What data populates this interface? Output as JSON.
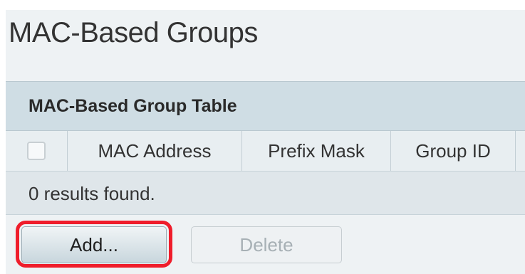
{
  "page": {
    "title": "MAC-Based Groups"
  },
  "table": {
    "title": "MAC-Based Group Table",
    "columns": [
      "",
      "MAC Address",
      "Prefix Mask",
      "Group ID"
    ],
    "results_text": "0 results found."
  },
  "actions": {
    "add_label": "Add...",
    "delete_label": "Delete"
  },
  "colors": {
    "background": "#eef2f4",
    "table_header": "#cfdde4",
    "results_row": "#dfe6ea",
    "highlight": "#ef1d2b"
  }
}
